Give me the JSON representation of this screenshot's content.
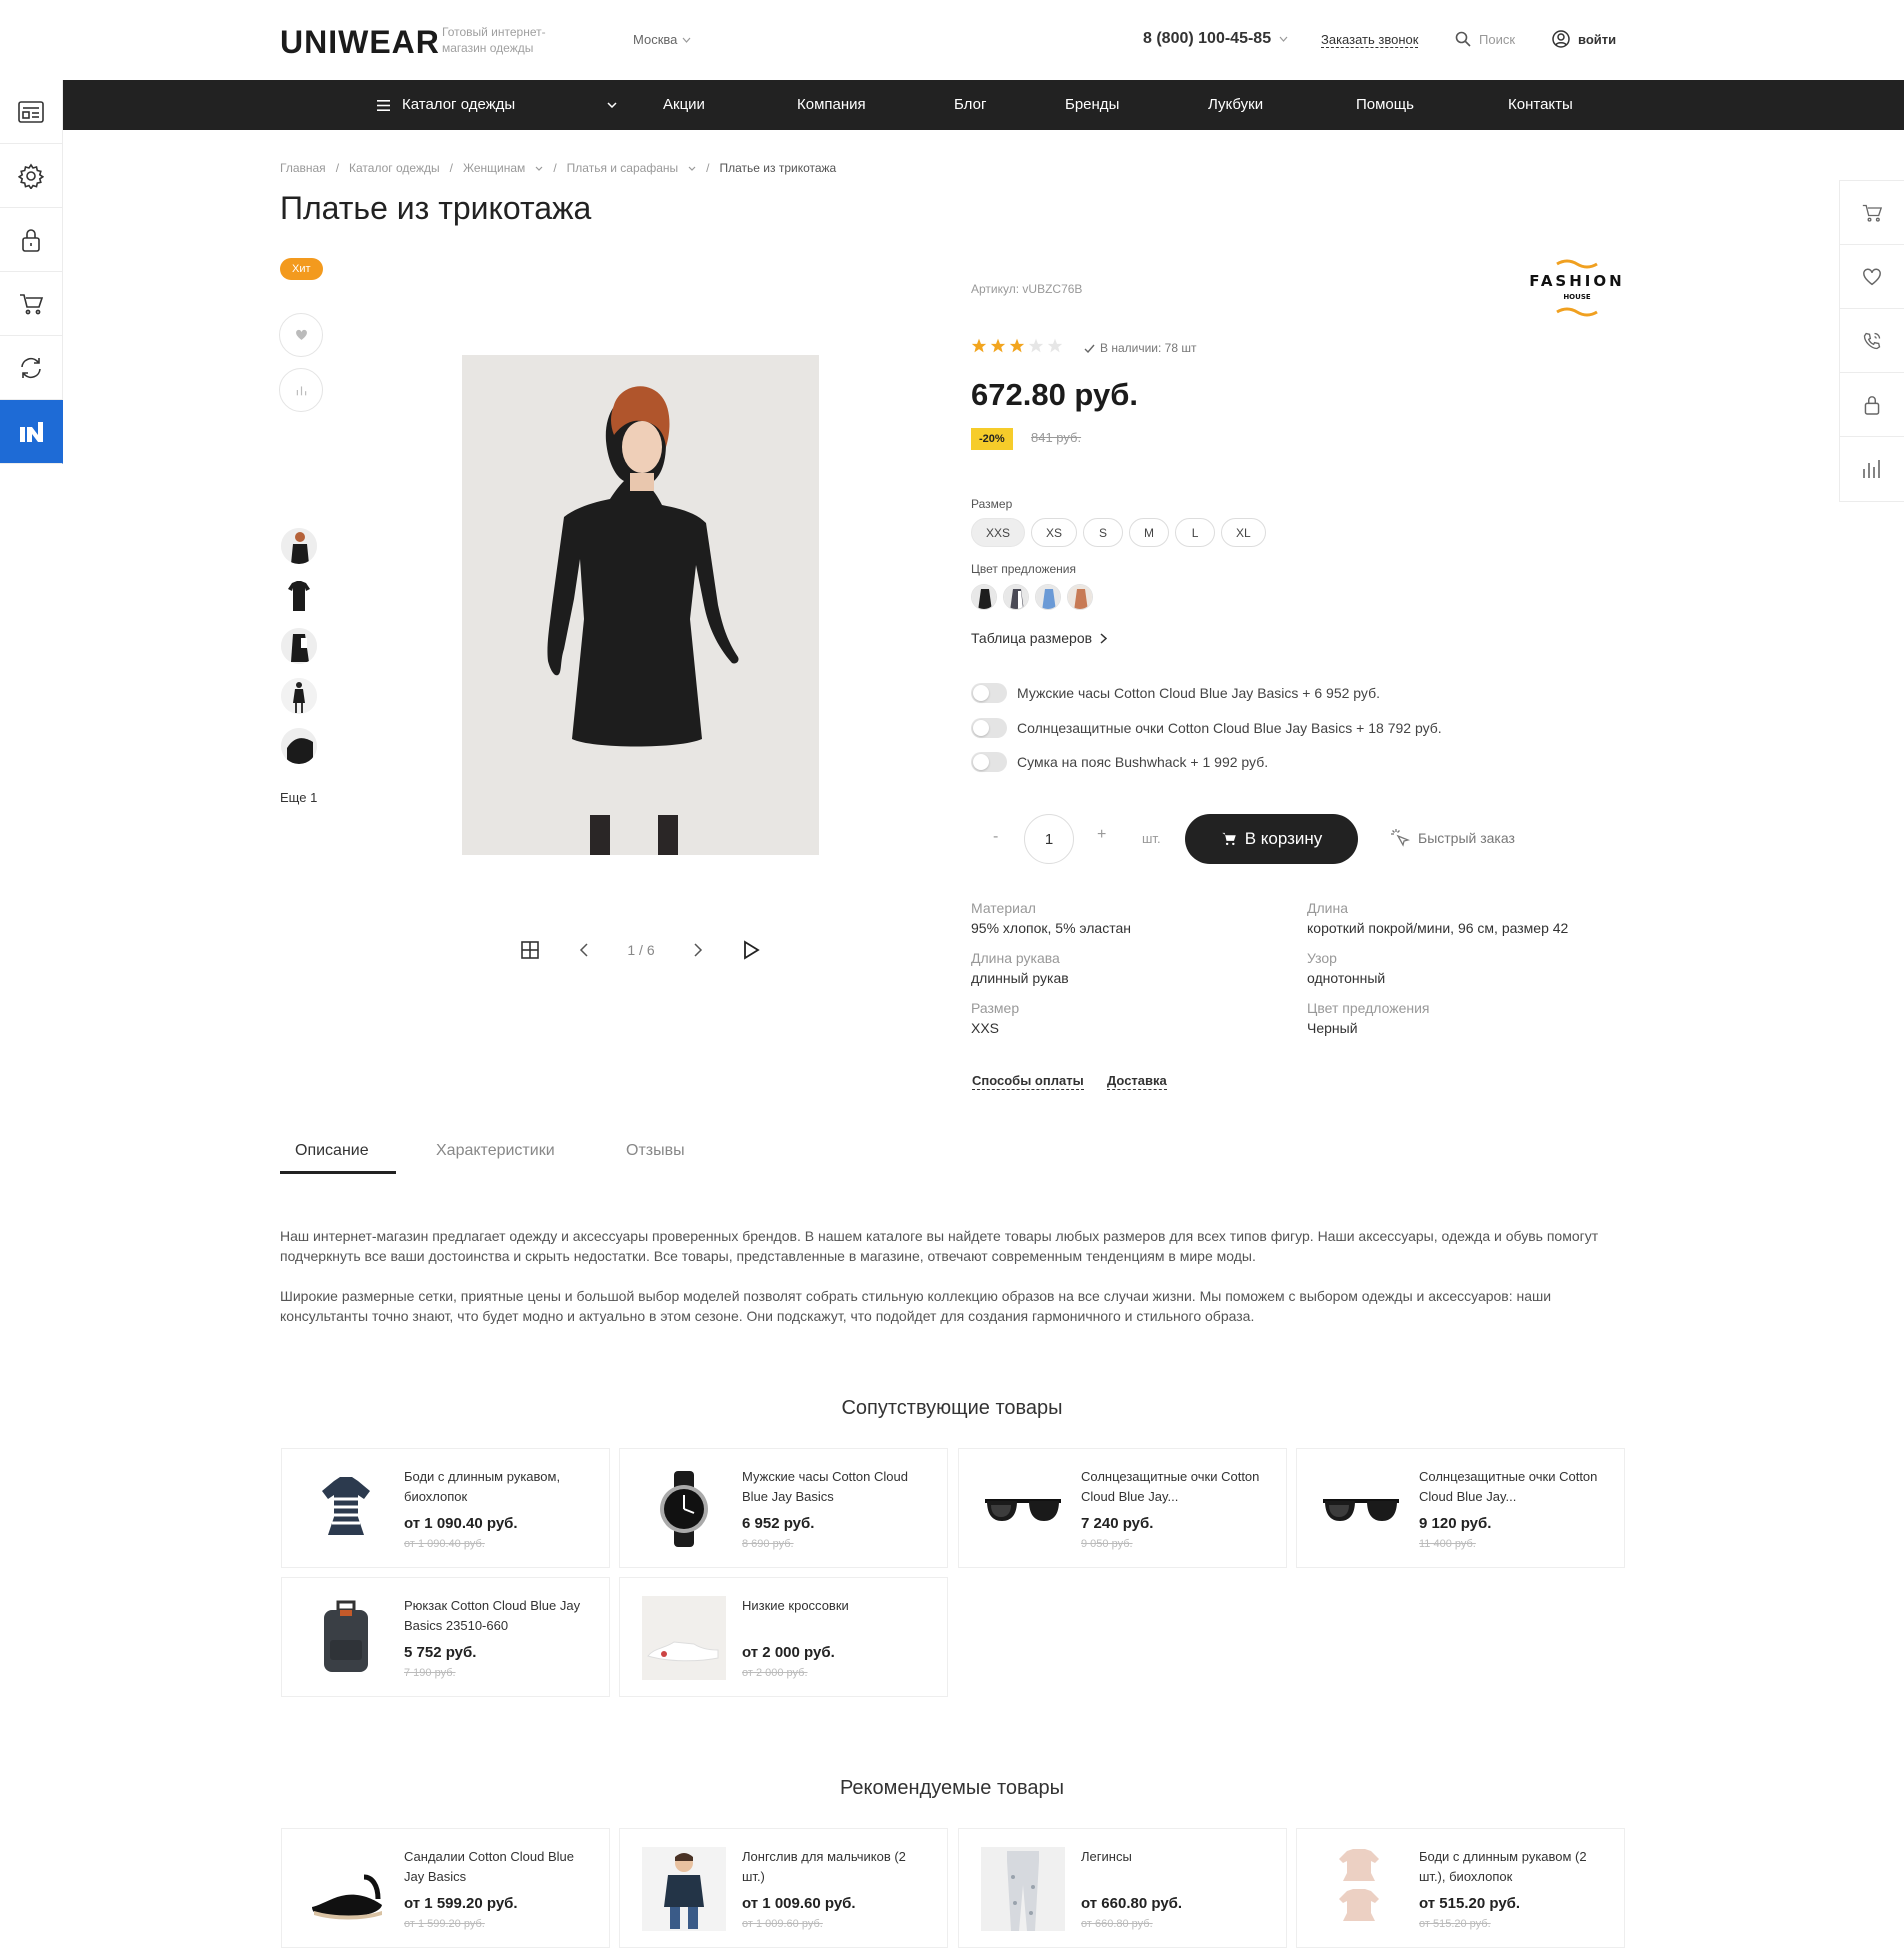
{
  "header": {
    "logo": "UNIWEAR",
    "logo_subtitle": "Готовый интернет-магазин одежды",
    "city": "Москва",
    "phone": "8 (800) 100-45-85",
    "callback": "Заказать звонок",
    "search": "Поиск",
    "login": "войти"
  },
  "nav": {
    "catalog": "Каталог одежды",
    "items": [
      "Акции",
      "Компания",
      "Блог",
      "Бренды",
      "Лукбуки",
      "Помощь",
      "Контакты"
    ]
  },
  "left_sidebar": [
    "catalog-icon",
    "gear-icon",
    "lock-icon",
    "cart-icon",
    "refresh-icon",
    "brand-icon"
  ],
  "right_sidebar": [
    "cart-icon",
    "heart-icon",
    "phone-icon",
    "lock-icon",
    "compare-icon"
  ],
  "breadcrumb": [
    "Главная",
    "Каталог одежды",
    "Женщинам",
    "Платья и сарафаны",
    "Платье из трикотажа"
  ],
  "product": {
    "title": "Платье из трикотажа",
    "badge": "Хит",
    "more_thumbs": "Еще 1",
    "gallery_counter": "1 / 6",
    "article": "Артикул: vUBZC76B",
    "brand": "FASHION",
    "brand_sub": "HOUSE",
    "rating": 3,
    "rating_max": 5,
    "stock": "В наличии: 78 шт",
    "price": "672.80 руб.",
    "discount": "-20%",
    "old_price": "841 руб.",
    "size_label": "Размер",
    "sizes": [
      "XXS",
      "XS",
      "S",
      "M",
      "L",
      "XL"
    ],
    "selected_size": "XXS",
    "color_label": "Цвет предложения",
    "colors": [
      "#2a2a2a",
      "#555555",
      "#6b9ad6",
      "#c77a55"
    ],
    "size_table": "Таблица размеров",
    "addons": [
      "Мужские часы Cotton Cloud Blue Jay Basics + 6 952 руб.",
      "Солнцезащитные очки Cotton Cloud Blue Jay Basics + 18 792 руб.",
      "Сумка на пояс Bushwhack + 1 992 руб."
    ],
    "qty_minus": "-",
    "quantity": "1",
    "qty_plus": "+",
    "qty_unit": "шт.",
    "cart_button": "В корзину",
    "quick_order": "Быстрый заказ",
    "props": [
      {
        "label": "Материал",
        "value": "95% хлопок, 5% эластан"
      },
      {
        "label": "Длина",
        "value": "короткий покрой/мини, 96 см, размер 42"
      },
      {
        "label": "Длина рукава",
        "value": "длинный рукав"
      },
      {
        "label": "Узор",
        "value": "однотонный"
      },
      {
        "label": "Размер",
        "value": "XXS"
      },
      {
        "label": "Цвет предложения",
        "value": "Черный"
      }
    ],
    "payment_link": "Способы оплаты",
    "delivery_link": "Доставка"
  },
  "tabs": [
    "Описание",
    "Характеристики",
    "Отзывы"
  ],
  "description": [
    "Наш интернет-магазин предлагает одежду и аксессуары проверенных брендов. В нашем каталоге вы найдете товары любых размеров для всех типов фигур. Наши аксессуары, одежда и обувь помогут подчеркнуть все ваши достоинства и скрыть недостатки. Все товары, представленные в магазине, отвечают современным тенденциям в мире моды.",
    "Широкие размерные сетки, приятные цены и большой выбор моделей позволят собрать стильную коллекцию образов на все случаи жизни. Мы поможем с выбором одежды и аксессуаров: наши консультанты точно знают, что будет модно и актуально в этом сезоне. Они подскажут, что подойдет для создания гармоничного и стильного образа."
  ],
  "related": {
    "title": "Сопутствующие товары",
    "items": [
      {
        "name": "Боди с длинным рукавом, биохлопок",
        "price": "от 1 090.40 руб.",
        "old": "от 1 090.40 руб.",
        "icon": "bodysuit-icon"
      },
      {
        "name": "Мужские часы Cotton Cloud Blue Jay Basics",
        "price": "6 952 руб.",
        "old": "8 690 руб.",
        "icon": "watch-icon"
      },
      {
        "name": "Солнцезащитные очки Cotton Cloud Blue Jay...",
        "price": "7 240 руб.",
        "old": "9 050 руб.",
        "icon": "sunglasses-icon"
      },
      {
        "name": "Солнцезащитные очки Cotton Cloud Blue Jay...",
        "price": "9 120 руб.",
        "old": "11 400 руб.",
        "icon": "sunglasses-icon"
      },
      {
        "name": "Рюкзак Cotton Cloud Blue Jay Basics 23510-660",
        "price": "5 752 руб.",
        "old": "7 190 руб.",
        "icon": "backpack-icon"
      },
      {
        "name": "Низкие кроссовки",
        "price": "от 2 000 руб.",
        "old": "от 2 000 руб.",
        "icon": "sneakers-icon"
      }
    ]
  },
  "recommended": {
    "title": "Рекомендуемые товары",
    "items": [
      {
        "name": "Сандалии Cotton Cloud Blue Jay Basics",
        "price": "от 1 599.20 руб.",
        "old": "от 1 599.20 руб.",
        "icon": "sandal-icon"
      },
      {
        "name": "Лонгслив для мальчиков (2 шт.)",
        "price": "от 1 009.60 руб.",
        "old": "от 1 009.60 руб.",
        "icon": "boy-icon"
      },
      {
        "name": "Легинсы",
        "price": "от 660.80 руб.",
        "old": "от 660.80 руб.",
        "icon": "leggings-icon"
      },
      {
        "name": "Боди с длинным рукавом (2 шт.), биохлопок",
        "price": "от 515.20 руб.",
        "old": "от 515.20 руб.",
        "icon": "bodysuit-icon"
      }
    ]
  }
}
